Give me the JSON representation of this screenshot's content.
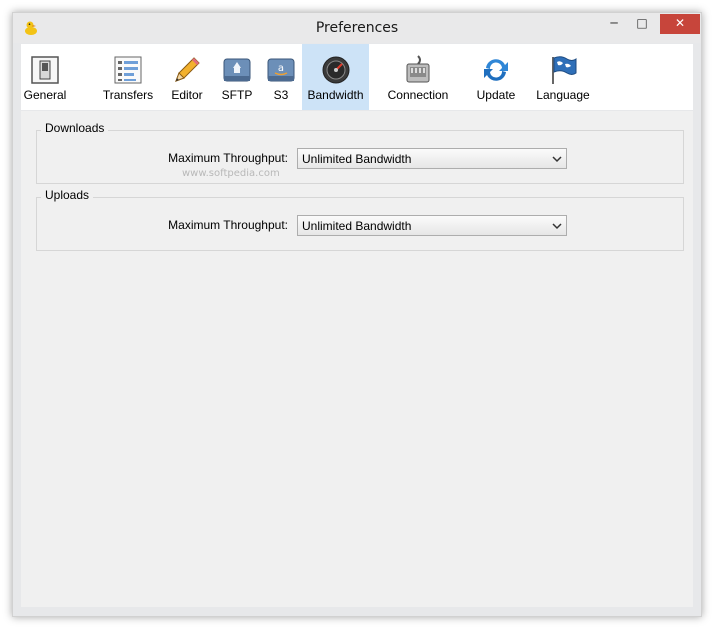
{
  "window": {
    "title": "Preferences"
  },
  "window_controls": {
    "minimize": "─",
    "maximize": "□",
    "close": "✕"
  },
  "tabs": [
    {
      "label": "General",
      "icon": "switch-icon"
    },
    {
      "label": "Transfers",
      "icon": "transfers-list-icon"
    },
    {
      "label": "Editor",
      "icon": "pencil-icon"
    },
    {
      "label": "SFTP",
      "icon": "sftp-disk-icon"
    },
    {
      "label": "S3",
      "icon": "amazon-s3-disk-icon"
    },
    {
      "label": "Bandwidth",
      "icon": "gauge-icon",
      "active": true
    },
    {
      "label": "Connection",
      "icon": "network-plug-icon"
    },
    {
      "label": "Update",
      "icon": "refresh-icon"
    },
    {
      "label": "Language",
      "icon": "flag-icon"
    }
  ],
  "downloads": {
    "group_label": "Downloads",
    "max_label": "Maximum Throughput:",
    "max_value": "Unlimited Bandwidth"
  },
  "uploads": {
    "group_label": "Uploads",
    "max_label": "Maximum Throughput:",
    "max_value": "Unlimited Bandwidth"
  },
  "watermark": "www.softpedia.com",
  "colors": {
    "active_tab": "#cde3f7",
    "close_button": "#c7453b"
  }
}
